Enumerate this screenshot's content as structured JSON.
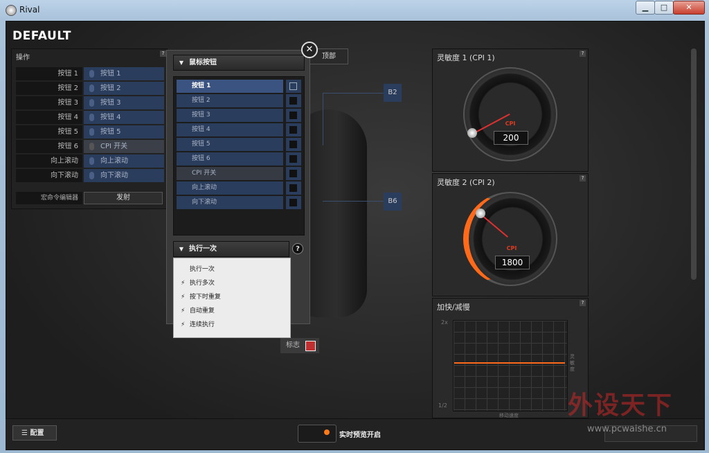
{
  "window": {
    "title": "Rival",
    "minimize": "▁",
    "maximize": "□",
    "close": "✕"
  },
  "profile": {
    "name": "DEFAULT"
  },
  "left_panel": {
    "title": "操作",
    "help": "?",
    "rows": [
      {
        "button": "按钮 1",
        "action": "按钮 1"
      },
      {
        "button": "按钮 2",
        "action": "按钮 2"
      },
      {
        "button": "按钮 3",
        "action": "按钮 3"
      },
      {
        "button": "按钮 4",
        "action": "按钮 4"
      },
      {
        "button": "按钮 5",
        "action": "按钮 5"
      },
      {
        "button": "按钮 6",
        "action": "CPI 开关"
      },
      {
        "button": "向上滚动",
        "action": "向上滚动"
      },
      {
        "button": "向下滚动",
        "action": "向下滚动"
      }
    ],
    "macro_label": "宏命令编辑器",
    "macro_button": "发射"
  },
  "center": {
    "top_tab": "顶部",
    "callouts": [
      "B2",
      "B6"
    ],
    "flag_label": "标志"
  },
  "popup": {
    "close": "✕",
    "dropdown": "鼠标按钮",
    "list": [
      "按钮 1",
      "按钮 2",
      "按钮 3",
      "按钮 4",
      "按钮 5",
      "按钮 6",
      "CPI 开关",
      "向上滚动",
      "向下滚动"
    ],
    "exec_dropdown": "执行一次",
    "help": "?",
    "exec_options": [
      "执行一次",
      "执行多次",
      "按下时重复",
      "自动重复",
      "连续执行"
    ]
  },
  "right": {
    "cpi1": {
      "title": "灵敏度 1 (CPI 1)",
      "label": "CPI",
      "value": "200",
      "help": "?"
    },
    "cpi2": {
      "title": "灵敏度 2 (CPI 2)",
      "label": "CPI",
      "value": "1800",
      "help": "?"
    },
    "accel": {
      "title": "加快/减慢",
      "help": "?",
      "y_top": "2x",
      "y_bottom": "1/2",
      "x_label": "移动速度",
      "right_label": "灵敏度"
    }
  },
  "bottom": {
    "config": "配置",
    "preview": "实时预览开启"
  },
  "watermark": {
    "text": "外设天下",
    "url": "www.pcwaishe.cn"
  },
  "colors": {
    "accent": "#ff6a1a",
    "row_blue": "#2b3d5c"
  }
}
